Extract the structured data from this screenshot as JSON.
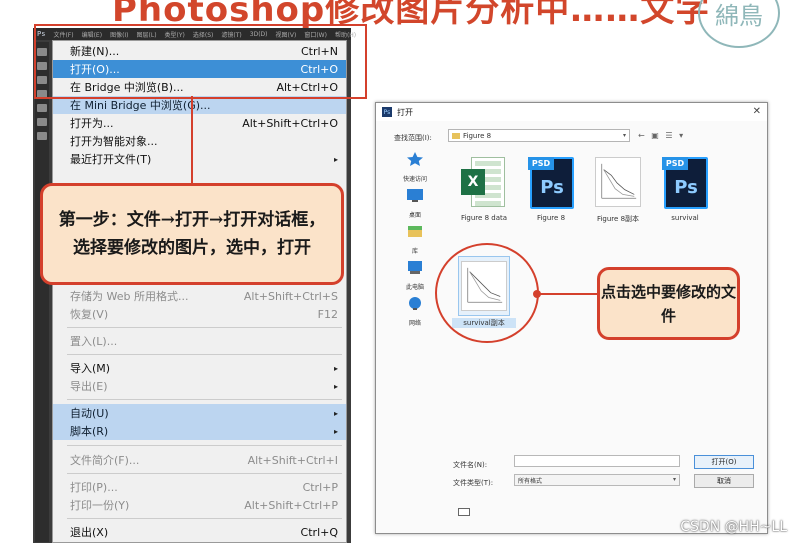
{
  "slide": {
    "title": "Photoshop修改图片分析中……文字",
    "seal_text": "綿鳥"
  },
  "ps": {
    "logo": "Ps",
    "menubar": [
      "文件(F)",
      "编辑(E)",
      "图像(I)",
      "图层(L)",
      "类型(Y)",
      "选择(S)",
      "滤镜(T)",
      "3D(D)",
      "视图(V)",
      "窗口(W)",
      "帮助(H)"
    ]
  },
  "file_menu": {
    "items": [
      {
        "label": "新建(N)...",
        "shortcut": "Ctrl+N"
      },
      {
        "label": "打开(O)...",
        "shortcut": "Ctrl+O"
      },
      {
        "label": "在 Bridge 中浏览(B)...",
        "shortcut": "Alt+Ctrl+O"
      },
      {
        "label": "在 Mini Bridge 中浏览(G)...",
        "shortcut": ""
      },
      {
        "label": "打开为...",
        "shortcut": "Alt+Shift+Ctrl+O"
      },
      {
        "label": "打开为智能对象...",
        "shortcut": ""
      },
      {
        "label": "最近打开文件(T)",
        "shortcut": ""
      },
      {
        "label": "存储为 Web 所用格式...",
        "shortcut": "Alt+Shift+Ctrl+S"
      },
      {
        "label": "恢复(V)",
        "shortcut": "F12"
      },
      {
        "label": "置入(L)...",
        "shortcut": ""
      },
      {
        "label": "导入(M)",
        "shortcut": ""
      },
      {
        "label": "导出(E)",
        "shortcut": ""
      },
      {
        "label": "自动(U)",
        "shortcut": ""
      },
      {
        "label": "脚本(R)",
        "shortcut": ""
      },
      {
        "label": "文件简介(F)...",
        "shortcut": "Alt+Shift+Ctrl+I"
      },
      {
        "label": "打印(P)...",
        "shortcut": "Ctrl+P"
      },
      {
        "label": "打印一份(Y)",
        "shortcut": "Alt+Shift+Ctrl+P"
      },
      {
        "label": "退出(X)",
        "shortcut": "Ctrl+Q"
      }
    ],
    "submenu_arrow": "▸"
  },
  "callouts": {
    "step_one": "第一步：文件→打开→打开对话框，选择要修改的图片，选中，打开",
    "select_file": "点击选中要修改的文件"
  },
  "dialog": {
    "title": "打开",
    "close_glyph": "✕",
    "look_in_label": "查找范围(I):",
    "look_in_value": "Figure 8",
    "nav_icons": "← ▣ ☰ ▾",
    "dropdown_glyph": "▾",
    "places": [
      {
        "label": "快速访问",
        "icon": "star-icon"
      },
      {
        "label": "桌面",
        "icon": "desktop-icon"
      },
      {
        "label": "库",
        "icon": "library-icon"
      },
      {
        "label": "此电脑",
        "icon": "computer-icon"
      },
      {
        "label": "网络",
        "icon": "network-icon"
      }
    ],
    "files": [
      {
        "name": "Figure 8 data",
        "type": "xlsx"
      },
      {
        "name": "Figure 8",
        "type": "psd"
      },
      {
        "name": "Figure 8副本",
        "type": "image"
      },
      {
        "name": "survival",
        "type": "psd"
      },
      {
        "name": "survival副本",
        "type": "image",
        "selected": true
      }
    ],
    "psd_tag": "PSD",
    "psd_letters": "Ps",
    "xls_letter": "X",
    "filename_label": "文件名(N):",
    "filename_value": "",
    "filetype_label": "文件类型(T):",
    "filetype_value": "所有格式",
    "open_button": "打开(O)",
    "cancel_button": "取消"
  },
  "watermark": "CSDN @HH~LL",
  "colors": {
    "accent_red": "#d4402c",
    "callout_fill": "#fbe3c9",
    "menu_highlight": "#3d8fd6"
  }
}
